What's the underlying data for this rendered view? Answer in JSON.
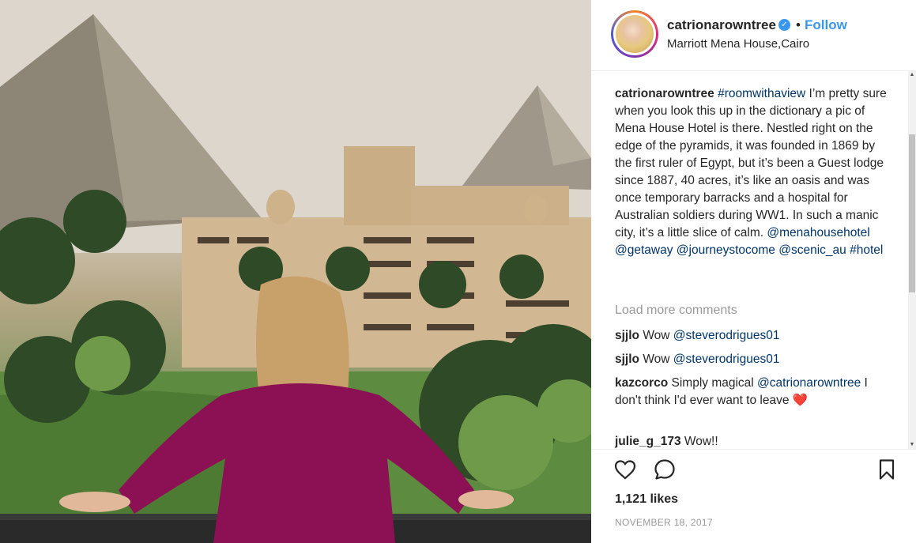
{
  "post": {
    "photo_alt": "",
    "username": "catrionarowntree",
    "verified_icon": "verified-badge-icon",
    "separator": "•",
    "follow_label": "Follow",
    "location": "Marriott Mena House,Cairo",
    "caption": {
      "username": "catrionarowntree",
      "hashtag": "#roomwithaview",
      "text": " I’m pretty sure when you look this up in the dictionary a pic of Mena House Hotel is there. Nestled right on the edge of the pyramids, it was founded in 1869 by the first ruler of Egypt, but it’s been a Guest lodge since 1887, 40 acres, it’s like an oasis and was once temporary barracks and a hospital for Australian soldiers during WW1. In such a manic city, it’s a little slice of calm. ",
      "tags": [
        "@menahousehotel",
        "@getaway",
        "@journeystocome",
        "@scenic_au",
        "#hotel"
      ]
    },
    "load_more": "Load more comments",
    "comments": [
      {
        "user": "sjjlo",
        "text_plain": " Wow ",
        "mention": "@steverodrigues01",
        "after": ""
      },
      {
        "user": "sjjlo",
        "text_plain": " Wow ",
        "mention": "@steverodrigues01",
        "after": ""
      },
      {
        "user": "kazcorco",
        "text_plain": " Simply magical ",
        "mention": "@catrionarowntree",
        "after": " I don't think I'd ever want to leave ",
        "emoji": "❤️"
      },
      {
        "user": "julie_g_173",
        "text_plain": " Wow!!",
        "mention": "",
        "after": ""
      }
    ],
    "likes": "1,121 likes",
    "date": "NOVEMBER 18, 2017"
  },
  "colors": {
    "link": "#3897f0",
    "hashtag": "#003569",
    "muted": "#999999",
    "text": "#262626"
  }
}
